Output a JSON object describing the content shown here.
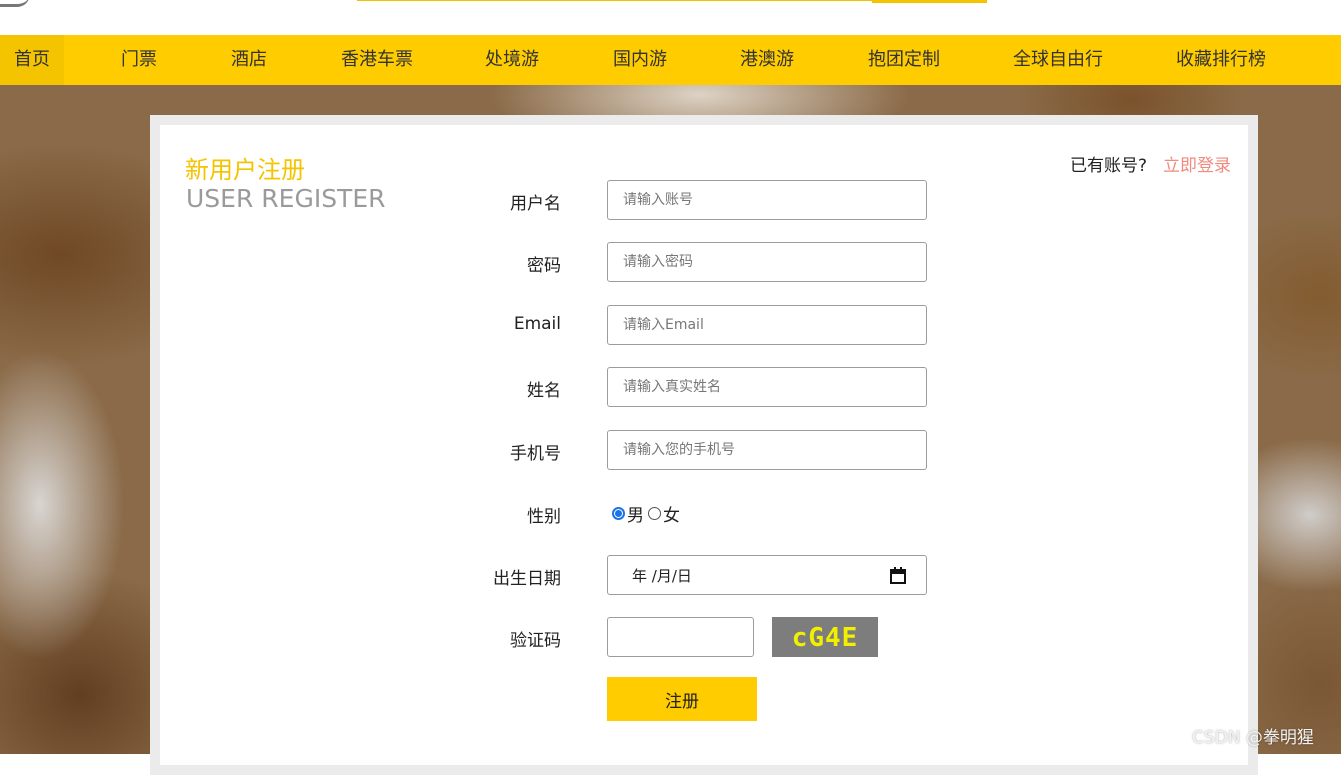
{
  "nav": {
    "items": [
      {
        "label": "首页",
        "active": true
      },
      {
        "label": "门票"
      },
      {
        "label": "酒店"
      },
      {
        "label": "香港车票"
      },
      {
        "label": "处境游"
      },
      {
        "label": "国内游"
      },
      {
        "label": "港澳游"
      },
      {
        "label": "抱团定制"
      },
      {
        "label": "全球自由行"
      },
      {
        "label": "收藏排行榜"
      }
    ]
  },
  "header": {
    "title_cn": "新用户注册",
    "title_en": "USER REGISTER",
    "have_account": "已有账号?",
    "login_link": "立即登录"
  },
  "form": {
    "username": {
      "label": "用户名",
      "placeholder": "请输入账号",
      "value": ""
    },
    "password": {
      "label": "密码",
      "placeholder": "请输入密码",
      "value": ""
    },
    "email": {
      "label": "Email",
      "placeholder": "请输入Email",
      "value": ""
    },
    "name": {
      "label": "姓名",
      "placeholder": "请输入真实姓名",
      "value": ""
    },
    "phone": {
      "label": "手机号",
      "placeholder": "请输入您的手机号",
      "value": ""
    },
    "gender": {
      "label": "性别",
      "options": [
        "男",
        "女"
      ],
      "selected": "男"
    },
    "birthday": {
      "label": "出生日期",
      "display": "年 /月/日"
    },
    "captcha": {
      "label": "验证码",
      "value": "",
      "code": "cG4E"
    },
    "submit_label": "注册"
  },
  "watermark": "CSDN @拳明猩",
  "colors": {
    "brand_yellow": "#ffcc00",
    "title_yellow": "#f5c400",
    "link_red": "#f08a7e",
    "radio_blue": "#1a73e8"
  }
}
